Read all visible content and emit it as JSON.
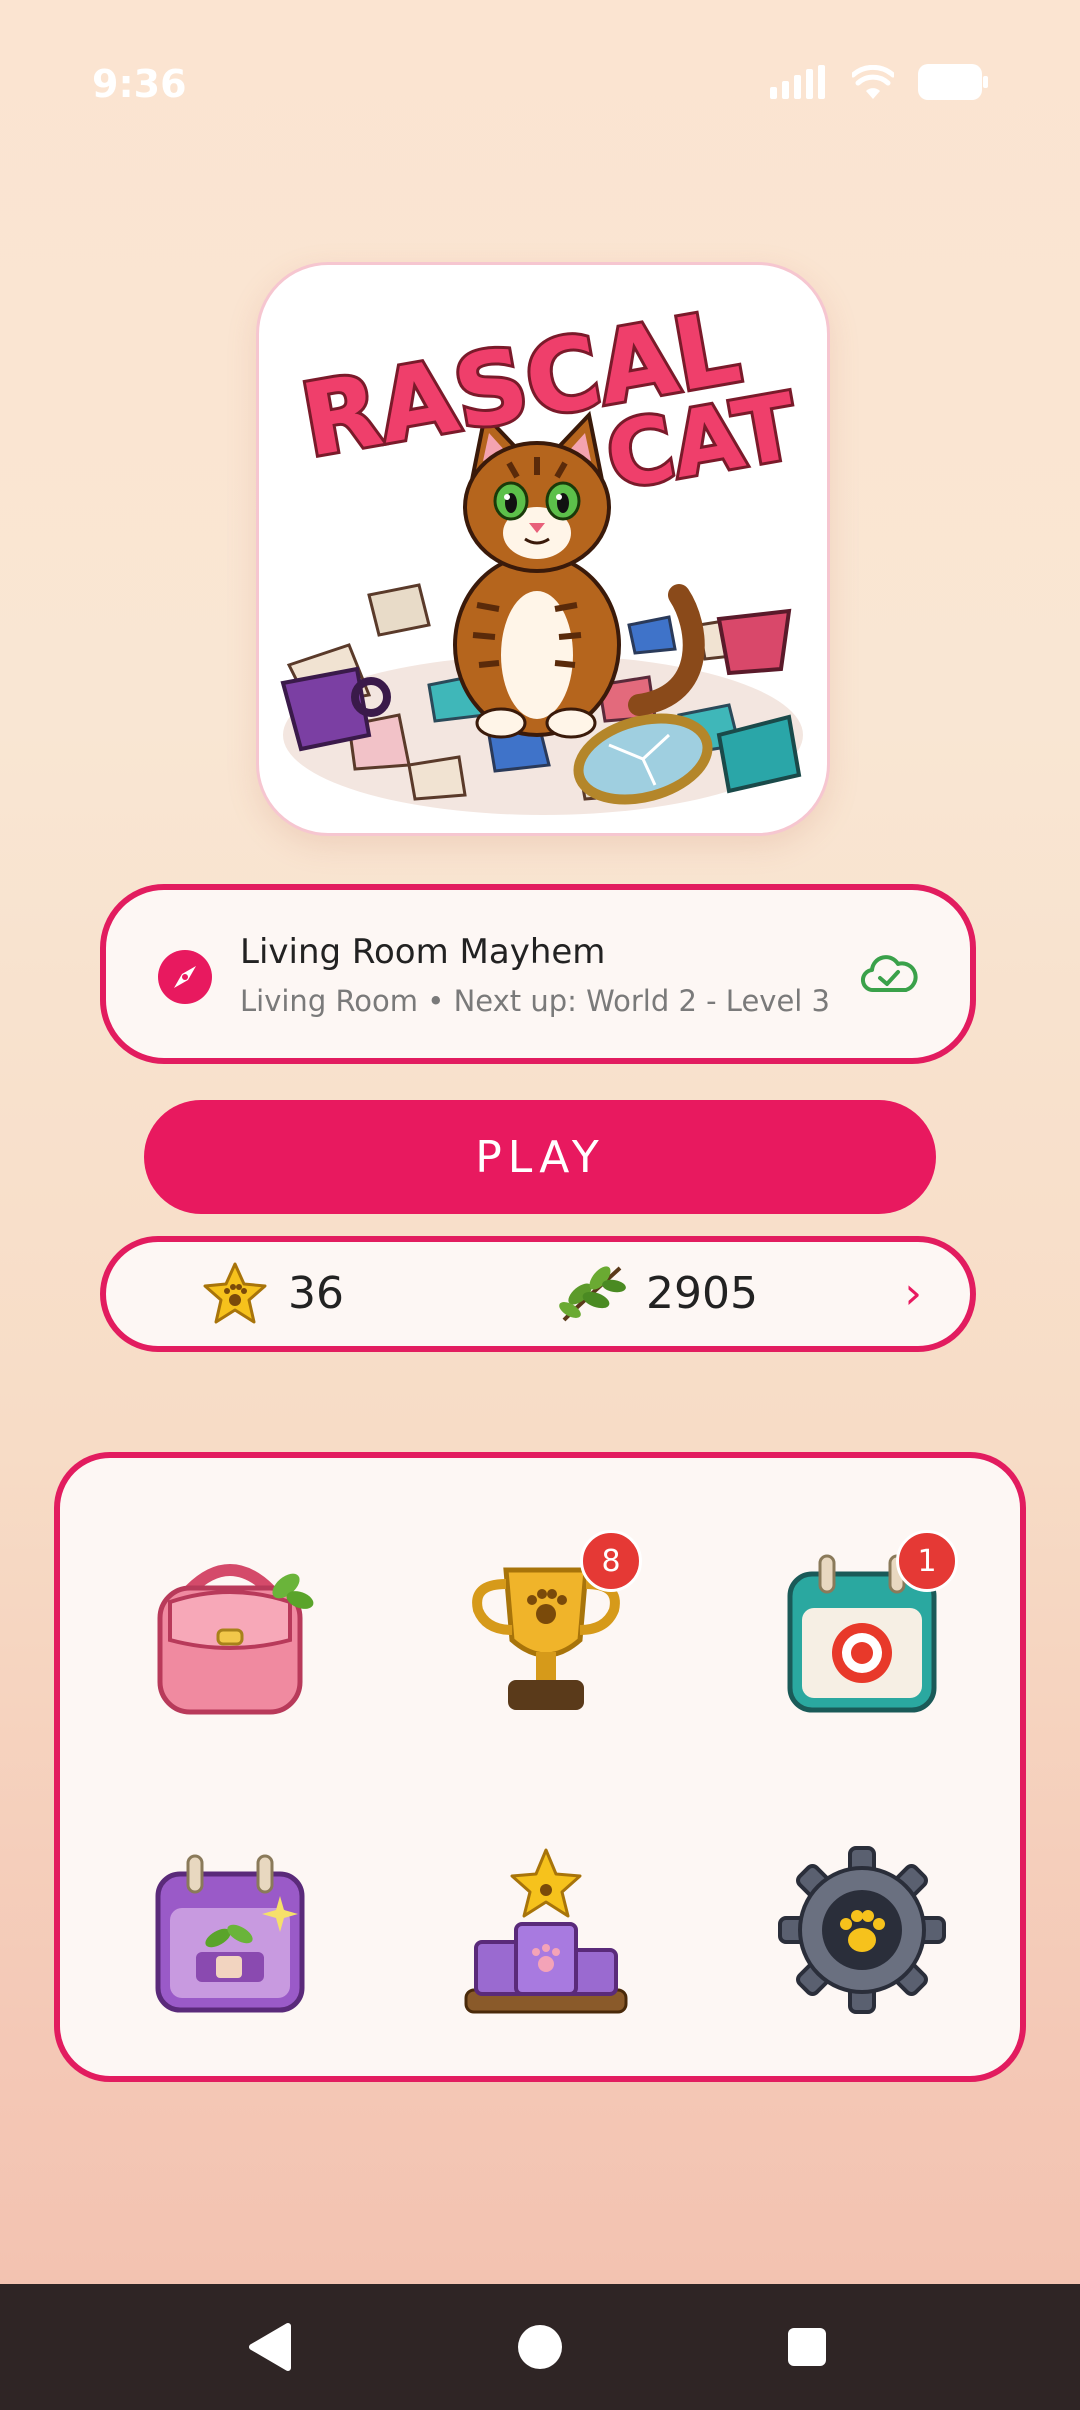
{
  "status_bar": {
    "time": "9:36",
    "icons": [
      "signal-icon",
      "wifi-icon",
      "battery-icon"
    ]
  },
  "logo": {
    "title_line1": "RASCAL",
    "title_line2": "CAT"
  },
  "world_card": {
    "title": "Living Room Mayhem",
    "subtitle": "Living Room • Next up: World 2 - Level 3",
    "icons": [
      "compass-icon",
      "cloud-check-icon"
    ]
  },
  "play_button": {
    "label": "PLAY"
  },
  "currencies": {
    "stars": "36",
    "catnip": "2905"
  },
  "menu": {
    "items": [
      {
        "icon": "backpack-icon",
        "badge": ""
      },
      {
        "icon": "trophy-icon",
        "badge": "8"
      },
      {
        "icon": "daily-calendar-icon",
        "badge": "1"
      },
      {
        "icon": "plant-calendar-icon",
        "badge": ""
      },
      {
        "icon": "podium-icon",
        "badge": ""
      },
      {
        "icon": "settings-gear-icon",
        "badge": ""
      }
    ]
  },
  "colors": {
    "accent": "#e8195f",
    "background": "#fbe4d1",
    "badge": "#e53935"
  }
}
